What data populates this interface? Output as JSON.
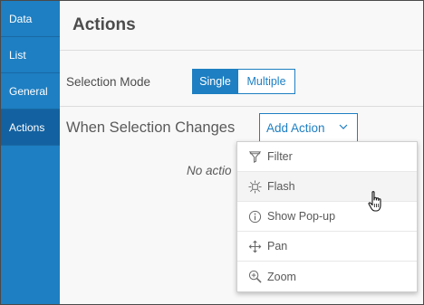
{
  "sidebar": {
    "items": [
      {
        "label": "Data",
        "active": false
      },
      {
        "label": "List",
        "active": false
      },
      {
        "label": "General",
        "active": false
      },
      {
        "label": "Actions",
        "active": true
      }
    ]
  },
  "header": {
    "title": "Actions"
  },
  "selection": {
    "label": "Selection Mode",
    "options": [
      "Single",
      "Multiple"
    ],
    "selected": "Single"
  },
  "when": {
    "label": "When Selection Changes",
    "add_button": "Add Action",
    "empty_text": "No actio"
  },
  "menu": {
    "items": [
      {
        "label": "Filter",
        "icon": "filter-icon"
      },
      {
        "label": "Flash",
        "icon": "flash-icon"
      },
      {
        "label": "Show Pop-up",
        "icon": "info-icon"
      },
      {
        "label": "Pan",
        "icon": "pan-icon"
      },
      {
        "label": "Zoom",
        "icon": "zoom-icon"
      }
    ],
    "hovered": "Flash"
  },
  "colors": {
    "accent": "#1e7fc2",
    "sidebar_active": "#1361a0",
    "text": "#4c4c4c"
  }
}
